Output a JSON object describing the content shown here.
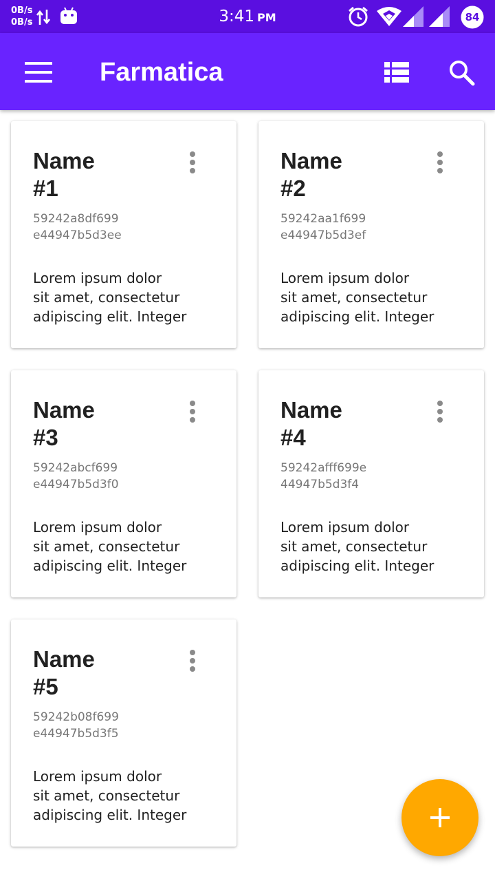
{
  "status_bar": {
    "net_up": "0B/s",
    "net_down": "0B/s",
    "time": "3:41",
    "ampm": "PM",
    "battery": "84",
    "icons": [
      "data-transfer-icon",
      "android-icon",
      "alarm-icon",
      "wifi-icon",
      "signal-icon",
      "signal-icon",
      "battery-icon"
    ]
  },
  "app_bar": {
    "title": "Farmatica",
    "icons": [
      "menu-icon",
      "view-list-icon",
      "search-icon"
    ]
  },
  "cards": [
    {
      "title_line1": "Name",
      "title_line2": "#1",
      "id_line1": "59242a8df699",
      "id_line2": "e44947b5d3ee",
      "desc_line1": "Lorem ipsum dolor",
      "desc_line2": "sit amet, consectetur",
      "desc_line3": "adipiscing elit. Integer"
    },
    {
      "title_line1": "Name",
      "title_line2": "#2",
      "id_line1": "59242aa1f699",
      "id_line2": "e44947b5d3ef",
      "desc_line1": "Lorem ipsum dolor",
      "desc_line2": "sit amet, consectetur",
      "desc_line3": "adipiscing elit. Integer"
    },
    {
      "title_line1": "Name",
      "title_line2": "#3",
      "id_line1": "59242abcf699",
      "id_line2": "e44947b5d3f0",
      "desc_line1": "Lorem ipsum dolor",
      "desc_line2": "sit amet, consectetur",
      "desc_line3": "adipiscing elit. Integer"
    },
    {
      "title_line1": "Name",
      "title_line2": "#4",
      "id_line1": "59242afff699e",
      "id_line2": "44947b5d3f4",
      "desc_line1": "Lorem ipsum dolor",
      "desc_line2": "sit amet, consectetur",
      "desc_line3": "adipiscing elit. Integer"
    },
    {
      "title_line1": "Name",
      "title_line2": "#5",
      "id_line1": "59242b08f699",
      "id_line2": "e44947b5d3f5",
      "desc_line1": "Lorem ipsum dolor",
      "desc_line2": "sit amet, consectetur",
      "desc_line3": "adipiscing elit. Integer"
    }
  ],
  "fab": {
    "icon": "add-icon",
    "color": "#ffa800"
  },
  "colors": {
    "status_bar": "#5a0fe0",
    "app_bar": "#6923ff",
    "accent": "#ffa800"
  }
}
